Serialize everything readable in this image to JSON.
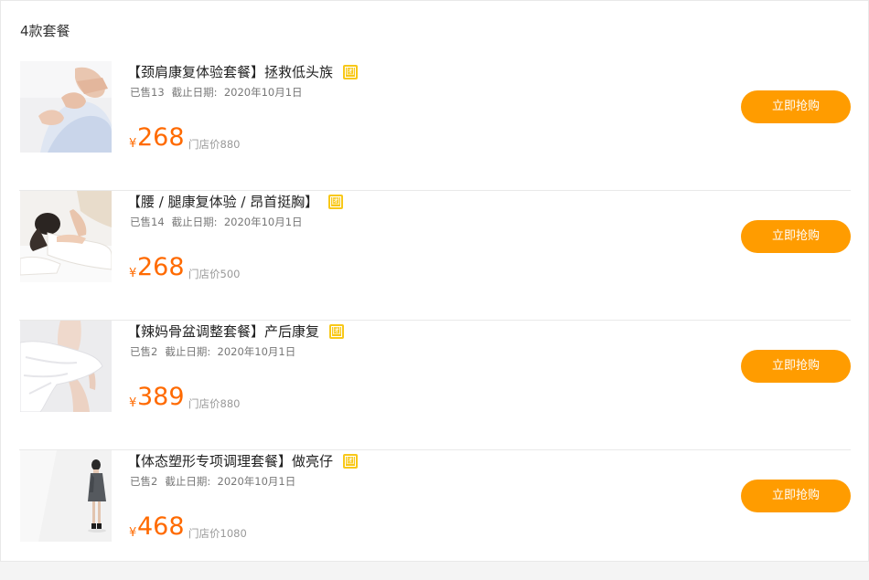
{
  "header": {
    "count_title": "4款套餐"
  },
  "items": [
    {
      "name": "【颈肩康复体验套餐】拯救低头族",
      "badge": "团",
      "sold": "已售13",
      "deadline_label": "截止日期:",
      "deadline": "2020年10月1日",
      "currency": "¥",
      "price": "268",
      "original_price": "门店价880",
      "buy_label": "立即抢购",
      "image": "neck-massage-photo"
    },
    {
      "name": "【腰 / 腿康复体验 / 昂首挺胸】",
      "badge": "团",
      "sold": "已售14",
      "deadline_label": "截止日期:",
      "deadline": "2020年10月1日",
      "currency": "¥",
      "price": "268",
      "original_price": "门店价500",
      "buy_label": "立即抢购",
      "image": "back-massage-photo"
    },
    {
      "name": "【辣妈骨盆调整套餐】产后康复",
      "badge": "团",
      "sold": "已售2",
      "deadline_label": "截止日期:",
      "deadline": "2020年10月1日",
      "currency": "¥",
      "price": "389",
      "original_price": "门店价880",
      "buy_label": "立即抢购",
      "image": "body-fabric-photo"
    },
    {
      "name": "【体态塑形专项调理套餐】做亮仔",
      "badge": "团",
      "sold": "已售2",
      "deadline_label": "截止日期:",
      "deadline": "2020年10月1日",
      "currency": "¥",
      "price": "468",
      "original_price": "门店价1080",
      "buy_label": "立即抢购",
      "image": "standing-woman-photo"
    }
  ],
  "colors": {
    "price": "#ff6a00",
    "button": "#ff9c00",
    "badge": "#f8c818"
  }
}
